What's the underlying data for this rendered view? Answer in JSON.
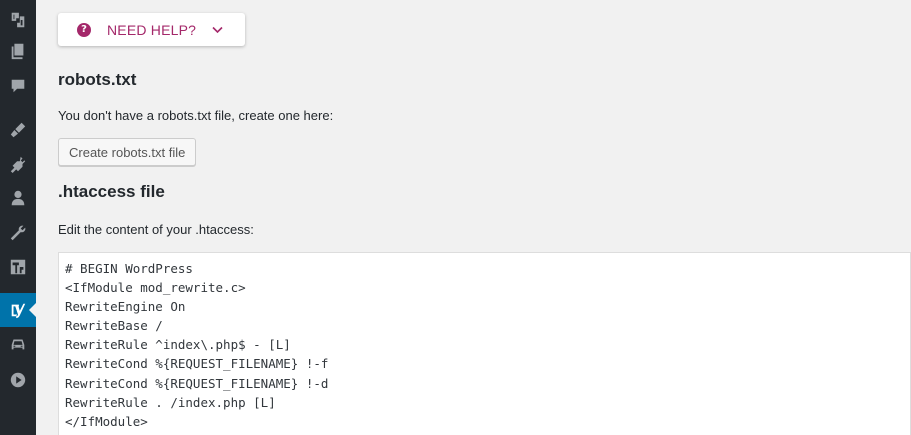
{
  "sidebar": {
    "items": [
      {
        "icon": "seo-icon"
      },
      {
        "icon": "pages-icon"
      },
      {
        "icon": "comments-icon"
      },
      {
        "icon": "appearance-icon"
      },
      {
        "icon": "plugins-icon"
      },
      {
        "icon": "users-icon"
      },
      {
        "icon": "tools-icon"
      },
      {
        "icon": "settings-icon"
      },
      {
        "icon": "yoast-icon",
        "active": true
      },
      {
        "icon": "car-icon"
      },
      {
        "icon": "play-icon"
      }
    ]
  },
  "help": {
    "label": "NEED HELP?",
    "color": "#a4286a"
  },
  "robots": {
    "heading": "robots.txt",
    "description": "You don't have a robots.txt file, create one here:",
    "button_label": "Create robots.txt file"
  },
  "htaccess": {
    "heading": ".htaccess file",
    "description": "Edit the content of your .htaccess:",
    "content": "# BEGIN WordPress\n<IfModule mod_rewrite.c>\nRewriteEngine On\nRewriteBase /\nRewriteRule ^index\\.php$ - [L]\nRewriteCond %{REQUEST_FILENAME} !-f\nRewriteCond %{REQUEST_FILENAME} !-d\nRewriteRule . /index.php [L]\n</IfModule>"
  },
  "colors": {
    "sidebar_bg": "#23282d",
    "sidebar_active": "#0073aa",
    "page_bg": "#f1f1f1"
  }
}
